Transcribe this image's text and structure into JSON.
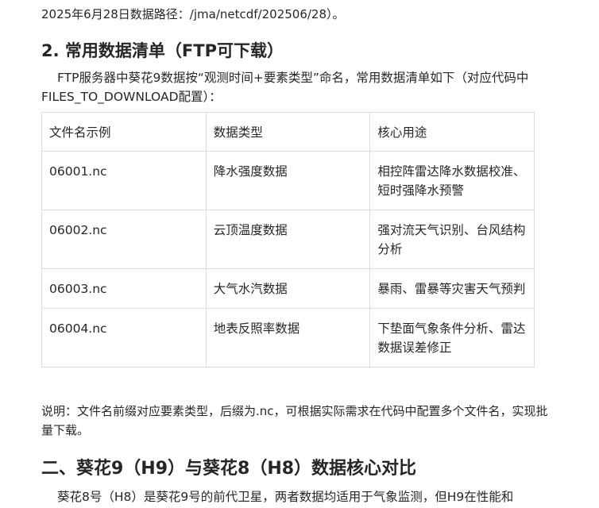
{
  "intro_tail": "2025年6月28日数据路径：/jma/netcdf/202506/28）。",
  "section_heading": "2. 常用数据清单（FTP可下载）",
  "section_intro": "FTP服务器中葵花9数据按“观测时间+要素类型”命名，常用数据清单如下（对应代码中FILES_TO_DOWNLOAD配置）：",
  "table": {
    "headers": [
      "文件名示例",
      "数据类型",
      "核心用途"
    ],
    "rows": [
      [
        "06001.nc",
        "降水强度数据",
        "相控阵雷达降水数据校准、短时强降水预警"
      ],
      [
        "06002.nc",
        "云顶温度数据",
        "强对流天气识别、台风结构分析"
      ],
      [
        "06003.nc",
        "大气水汽数据",
        "暴雨、雷暴等灾害天气预判"
      ],
      [
        "06004.nc",
        "地表反照率数据",
        "下垫面气象条件分析、雷达数据误差修正"
      ]
    ]
  },
  "note": "说明：文件名前缀对应要素类型，后缀为.nc，可根据实际需求在代码中配置多个文件名，实现批量下载。",
  "next_heading": "二、葵花9（H9）与葵花8（H8）数据核心对比",
  "next_para": "葵花8号（H8）是葵花9号的前代卫星，两者数据均适用于气象监测，但H9在性能和"
}
